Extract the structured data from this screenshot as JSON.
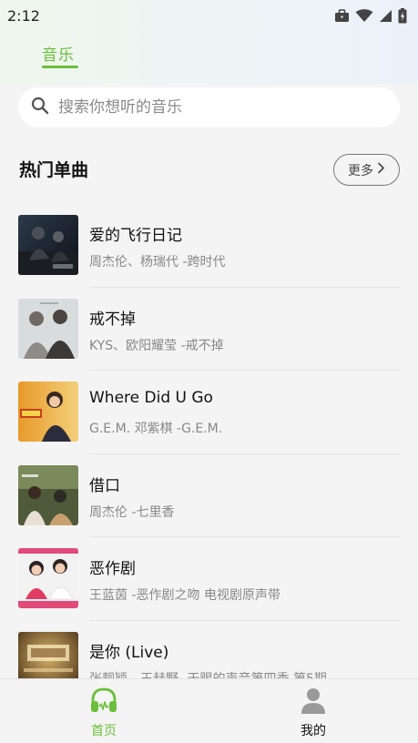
{
  "status_bar": {
    "time": "2:12"
  },
  "tabs": [
    {
      "label": "音乐",
      "active": true
    }
  ],
  "search": {
    "placeholder": "搜索你想听的音乐"
  },
  "section": {
    "title": "热门单曲",
    "more_label": "更多"
  },
  "songs": [
    {
      "title": "爱的飞行日记",
      "subtitle": "周杰伦、杨瑞代 -跨时代"
    },
    {
      "title": "戒不掉",
      "subtitle": "KYS、欧阳耀莹 -戒不掉"
    },
    {
      "title": "Where Did U Go",
      "subtitle": "G.E.M. 邓紫棋 -G.E.M."
    },
    {
      "title": "借口",
      "subtitle": "周杰伦 -七里香"
    },
    {
      "title": "恶作剧",
      "subtitle": "王蓝茵 -恶作剧之吻 电视剧原声带"
    },
    {
      "title": "是你 (Live)",
      "subtitle": "张靓颖、王赫野 -天赐的声音第四季 第5期"
    }
  ],
  "bottom_nav": [
    {
      "label": "首页",
      "icon": "headphones-icon",
      "active": true
    },
    {
      "label": "我的",
      "icon": "person-icon",
      "active": false
    }
  ],
  "colors": {
    "accent": "#6bbf3a",
    "background": "#f4f4f4",
    "subtitle": "#888888"
  }
}
